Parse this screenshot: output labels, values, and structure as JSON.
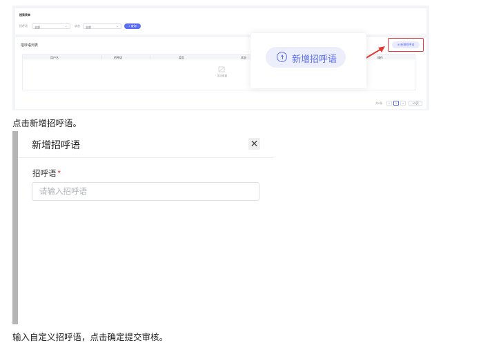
{
  "top": {
    "search_section_title": "搜索表单",
    "filter1_label": "招呼语",
    "filter1_value": "全部",
    "filter2_label": "状态",
    "filter2_value": "全部",
    "query_label": "查询",
    "list_title": "招呼语列表",
    "add_small_label": "新增招呼语",
    "columns": [
      "用户名",
      "招呼语",
      "类型",
      "状态",
      "操作"
    ],
    "empty_text": "暂无数据",
    "pagination": {
      "total": "共0条",
      "prev": "<",
      "page": "1",
      "next": ">",
      "per_page": "10/页"
    },
    "callout_label": "新增招呼语"
  },
  "captions": {
    "step1": "点击新增招呼语。",
    "step2": "输入自定义招呼语，点击确定提交审核。"
  },
  "dialog": {
    "title": "新增招呼语",
    "close_glyph": "✕",
    "field_label": "招呼语",
    "required_mark": "*",
    "input_placeholder": "请输入招呼语",
    "input_value": ""
  },
  "colors": {
    "accent": "#5b6ef1",
    "highlight": "#e53935"
  }
}
